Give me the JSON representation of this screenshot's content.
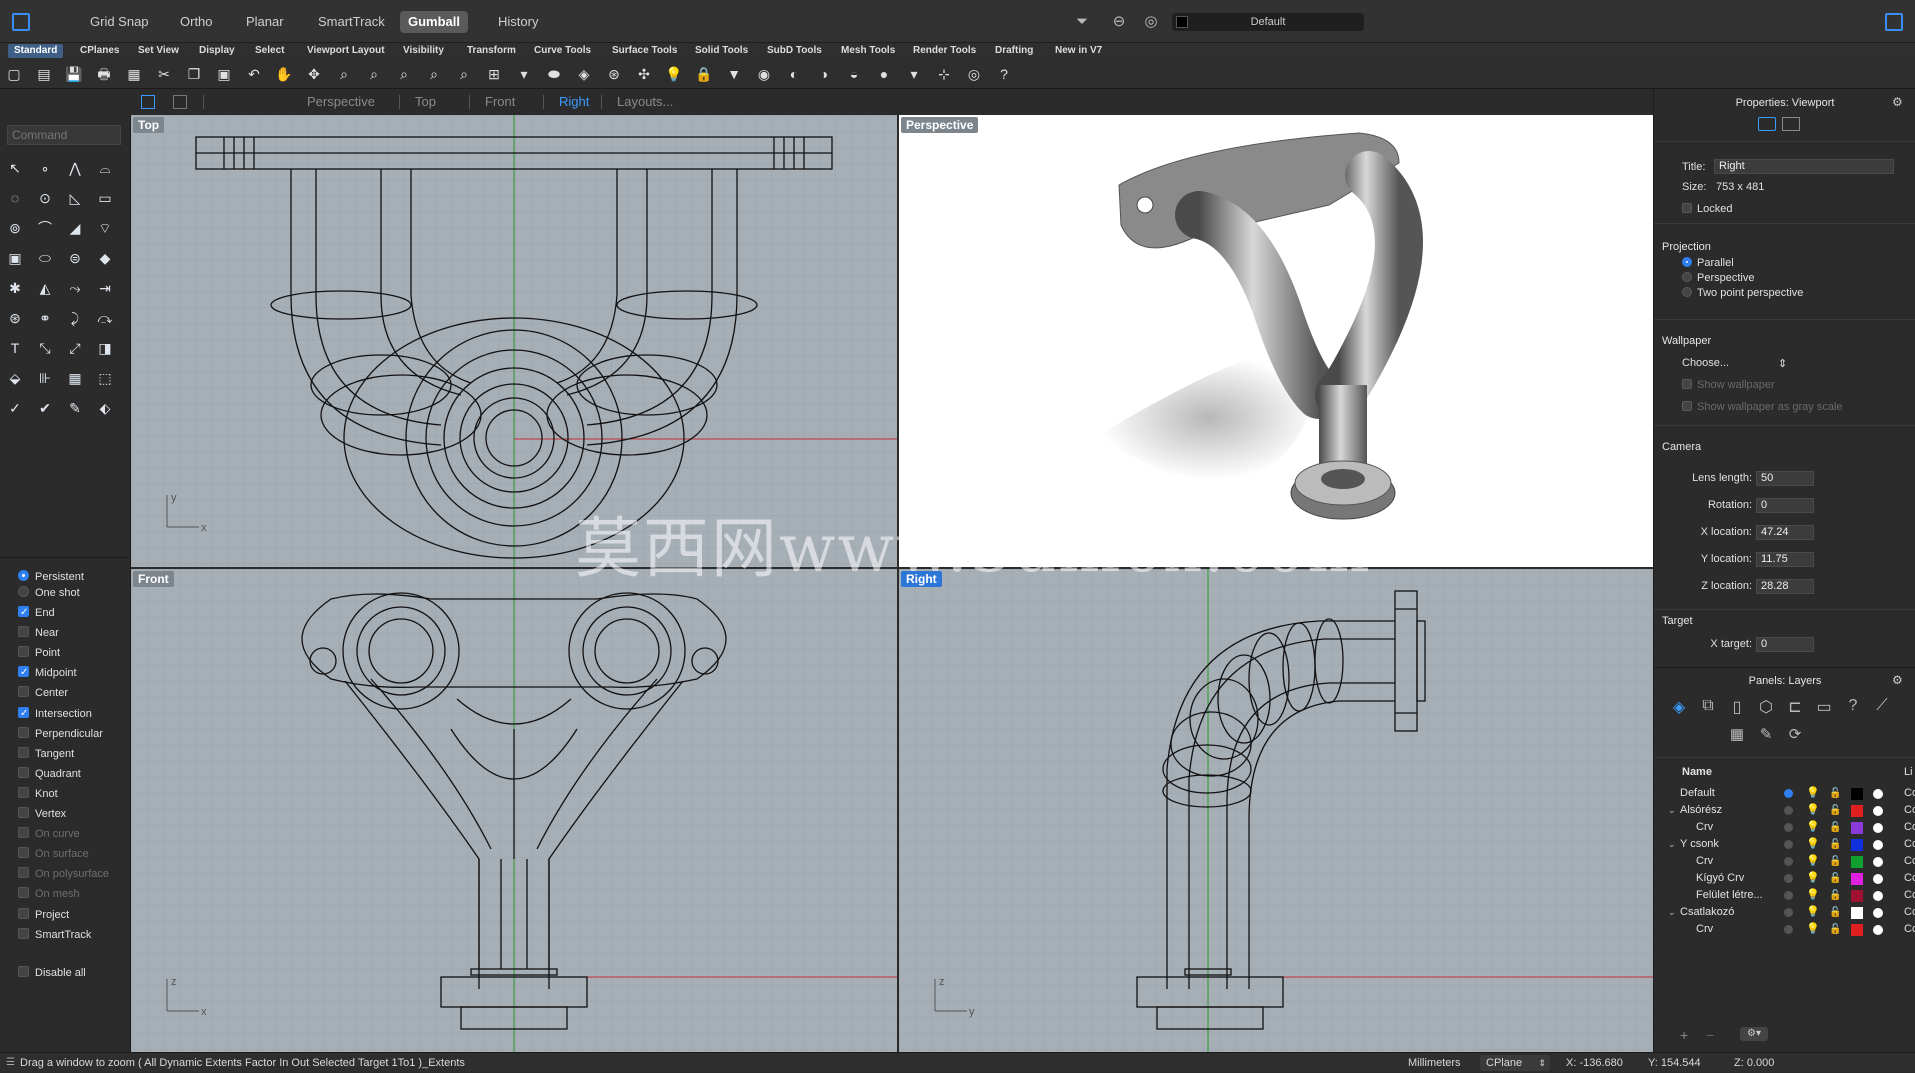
{
  "topbar": {
    "modes": [
      {
        "label": "Grid Snap",
        "active": false
      },
      {
        "label": "Ortho",
        "active": false
      },
      {
        "label": "Planar",
        "active": false
      },
      {
        "label": "SmartTrack",
        "active": false
      },
      {
        "label": "Gumball",
        "active": true
      },
      {
        "label": "History",
        "active": false
      }
    ],
    "display_mode": "Default"
  },
  "tabs": [
    "Standard",
    "CPlanes",
    "Set View",
    "Display",
    "Select",
    "Viewport Layout",
    "Visibility",
    "Transform",
    "Curve Tools",
    "Surface Tools",
    "Solid Tools",
    "SubD Tools",
    "Mesh Tools",
    "Render Tools",
    "Drafting",
    "New in V7"
  ],
  "active_tab": "Standard",
  "viewport_tabs": [
    "Perspective",
    "Top",
    "Front",
    "Right",
    "Layouts..."
  ],
  "active_viewport_tab": "Right",
  "command": {
    "placeholder": "Command"
  },
  "osnaps": {
    "mode": [
      {
        "label": "Persistent",
        "on": true
      },
      {
        "label": "One shot",
        "on": false
      }
    ],
    "items": [
      {
        "label": "End",
        "on": true,
        "dim": false
      },
      {
        "label": "Near",
        "on": false,
        "dim": false
      },
      {
        "label": "Point",
        "on": false,
        "dim": false
      },
      {
        "label": "Midpoint",
        "on": true,
        "dim": false
      },
      {
        "label": "Center",
        "on": false,
        "dim": false
      },
      {
        "label": "Intersection",
        "on": true,
        "dim": false
      },
      {
        "label": "Perpendicular",
        "on": false,
        "dim": false
      },
      {
        "label": "Tangent",
        "on": false,
        "dim": false
      },
      {
        "label": "Quadrant",
        "on": false,
        "dim": false
      },
      {
        "label": "Knot",
        "on": false,
        "dim": false
      },
      {
        "label": "Vertex",
        "on": false,
        "dim": false
      },
      {
        "label": "On curve",
        "on": false,
        "dim": true
      },
      {
        "label": "On surface",
        "on": false,
        "dim": true
      },
      {
        "label": "On polysurface",
        "on": false,
        "dim": true
      },
      {
        "label": "On mesh",
        "on": false,
        "dim": true
      },
      {
        "label": "Project",
        "on": false,
        "dim": false
      },
      {
        "label": "SmartTrack",
        "on": false,
        "dim": false
      }
    ],
    "disable_all": "Disable all"
  },
  "viewports": {
    "top": {
      "label": "Top",
      "axis_a": "y",
      "axis_b": "x"
    },
    "perspective": {
      "label": "Perspective"
    },
    "front": {
      "label": "Front",
      "axis_a": "z",
      "axis_b": "x"
    },
    "right": {
      "label": "Right",
      "axis_a": "z",
      "axis_b": "y"
    }
  },
  "watermark": "莫西网www.3dmox.com",
  "properties": {
    "header": "Properties: Viewport",
    "title_label": "Title:",
    "title_value": "Right",
    "size_label": "Size:",
    "size_value": "753 x 481",
    "locked_label": "Locked",
    "projection_label": "Projection",
    "projection_options": [
      {
        "label": "Parallel",
        "on": true
      },
      {
        "label": "Perspective",
        "on": false
      },
      {
        "label": "Two point perspective",
        "on": false
      }
    ],
    "wallpaper_label": "Wallpaper",
    "wallpaper_choose": "Choose...",
    "show_wallpaper": "Show wallpaper",
    "show_wallpaper_gray": "Show wallpaper as gray scale",
    "camera_label": "Camera",
    "camera_fields": [
      {
        "label": "Lens length:",
        "value": "50"
      },
      {
        "label": "Rotation:",
        "value": "0"
      },
      {
        "label": "X location:",
        "value": "47.24"
      },
      {
        "label": "Y location:",
        "value": "11.75"
      },
      {
        "label": "Z location:",
        "value": "28.28"
      }
    ],
    "target_label": "Target",
    "target_fields": [
      {
        "label": "X target:",
        "value": "0"
      }
    ]
  },
  "layers": {
    "header": "Panels: Layers",
    "col_name": "Name",
    "col_linetype": "Li",
    "rows": [
      {
        "name": "Default",
        "indent": 0,
        "expander": "",
        "current": true,
        "color": "#000000",
        "lt": "Co"
      },
      {
        "name": "Alsórész",
        "indent": 0,
        "expander": "v",
        "current": false,
        "color": "#e02020",
        "lt": "Co"
      },
      {
        "name": "Crv",
        "indent": 1,
        "expander": "",
        "current": false,
        "color": "#8a3ad8",
        "lt": "Co"
      },
      {
        "name": "Y csonk",
        "indent": 0,
        "expander": "v",
        "current": false,
        "color": "#1030e0",
        "lt": "Co"
      },
      {
        "name": "Crv",
        "indent": 1,
        "expander": "",
        "current": false,
        "color": "#10a030",
        "lt": "Co"
      },
      {
        "name": "Kígyó Crv",
        "indent": 1,
        "expander": "",
        "current": false,
        "color": "#e020e0",
        "lt": "Co"
      },
      {
        "name": "Felület létre...",
        "indent": 1,
        "expander": "",
        "current": false,
        "color": "#a01030",
        "lt": "Co"
      },
      {
        "name": "Csatlakozó",
        "indent": 0,
        "expander": "v",
        "current": false,
        "color": "#ffffff",
        "lt": "Co"
      },
      {
        "name": "Crv",
        "indent": 1,
        "expander": "",
        "current": false,
        "color": "#e02020",
        "lt": "Co"
      }
    ]
  },
  "status": {
    "prompt": "Drag a window to zoom ( All Dynamic Extents Factor In Out Selected Target 1To1 )_Extents",
    "units": "Millimeters",
    "cplane": "CPlane",
    "x": "X: -136.680",
    "y": "Y: 154.544",
    "z": "Z: 0.000"
  },
  "icons": [
    "rhino-window-icon",
    "filter-icon",
    "record-icon",
    "target-icon",
    "panel-toggle-icon"
  ]
}
